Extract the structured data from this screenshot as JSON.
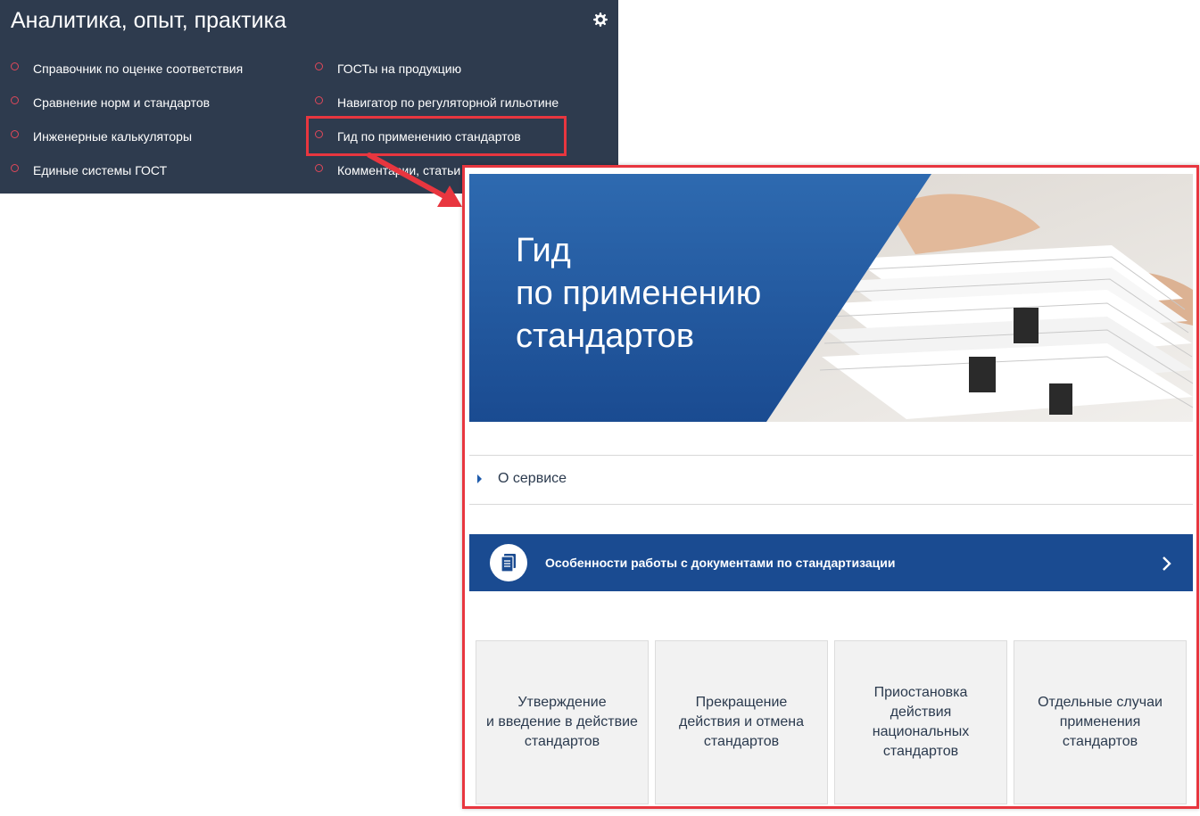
{
  "menu": {
    "title": "Аналитика, опыт, практика",
    "accent_color": "#e0485a",
    "left_items": [
      {
        "label": "Справочник по оценке соответствия"
      },
      {
        "label": "Сравнение норм и стандартов"
      },
      {
        "label": "Инженерные калькуляторы"
      },
      {
        "label": "Единые системы ГОСТ"
      }
    ],
    "right_items": [
      {
        "label": "ГОСТы на продукцию"
      },
      {
        "label": "Навигатор по регуляторной гильотине"
      },
      {
        "label": "Гид по применению стандартов"
      },
      {
        "label": "Комментарии, статьи"
      }
    ],
    "highlighted_item": "Гид по применению стандартов"
  },
  "page": {
    "hero": {
      "title_lines": [
        "Гид",
        "по применению",
        "стандартов"
      ]
    },
    "about": {
      "label": "О сервисе",
      "icon": "caret-right-icon"
    },
    "banner": {
      "label": "Особенности работы с документами по стандартизации",
      "icon": "document-icon",
      "chevron": "chevron-right-icon",
      "color": "#1a4b91"
    },
    "cards": [
      {
        "label": "Утверждение\nи введение в действие\nстандартов"
      },
      {
        "label": "Прекращение\nдействия и отмена\nстандартов"
      },
      {
        "label": "Приостановка\nдействия\nнациональных\nстандартов"
      },
      {
        "label": "Отдельные случаи\nприменения\nстандартов"
      }
    ]
  },
  "annotation": {
    "highlight_color": "#e8363f"
  }
}
